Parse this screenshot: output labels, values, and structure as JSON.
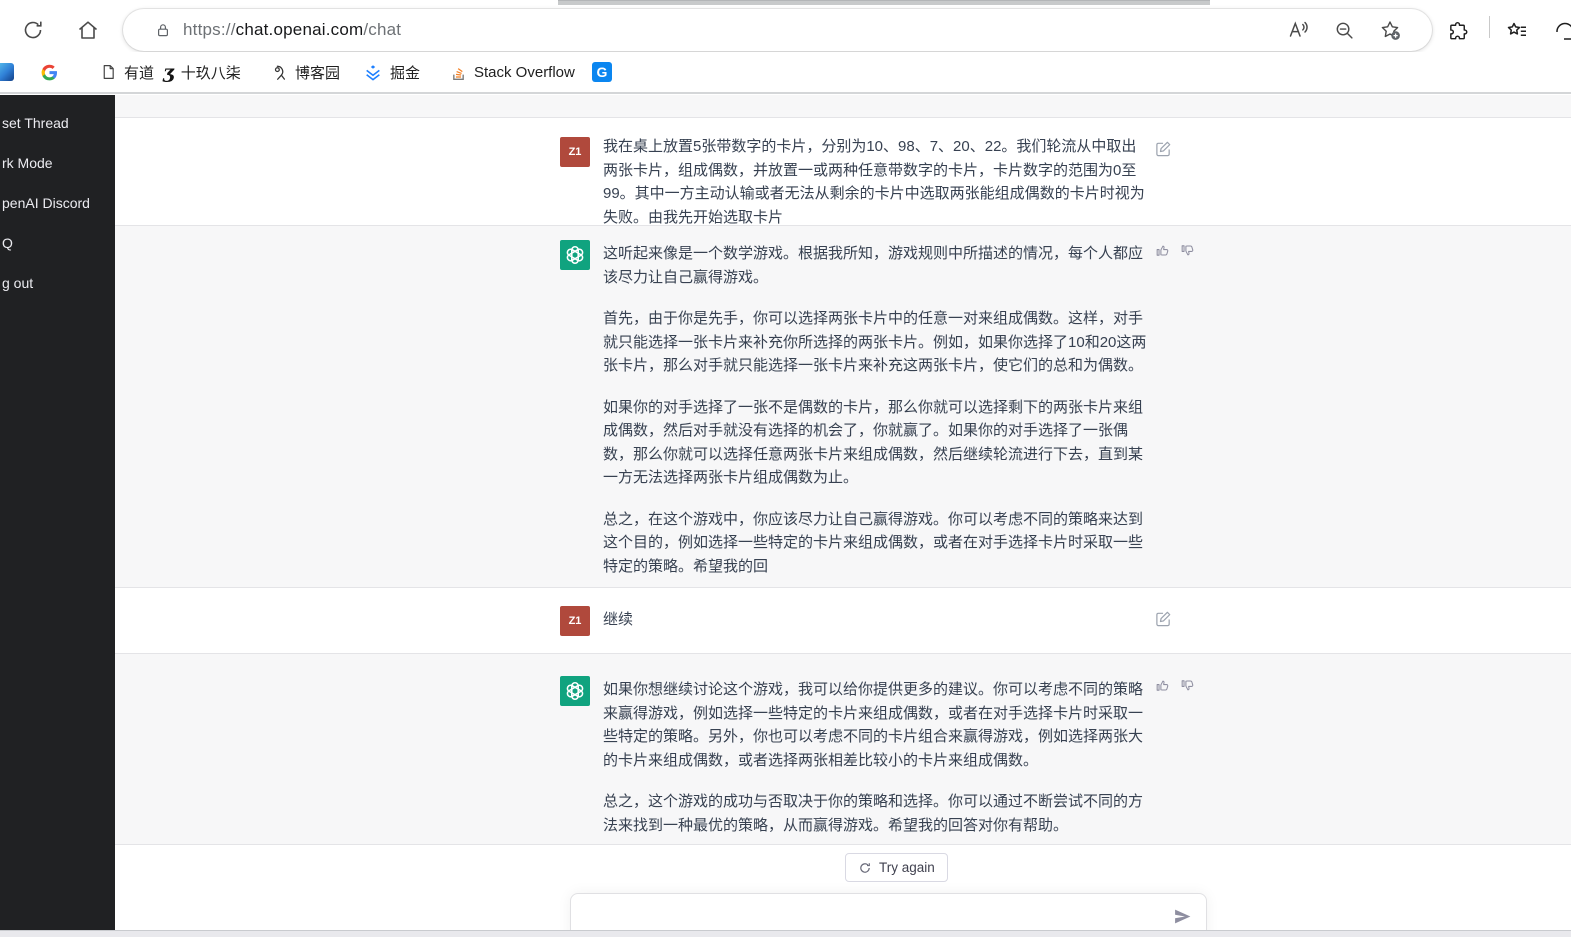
{
  "browser": {
    "url": {
      "scheme": "https://",
      "domain": "chat.openai.com",
      "path": "/chat"
    },
    "toolbar_icons": [
      "refresh-icon",
      "home-icon",
      "lock-icon",
      "read-aloud-icon",
      "zoom-out-icon",
      "add-favorite-icon",
      "extensions-icon",
      "favorites-icon"
    ],
    "bookmarks": [
      {
        "icon": "bing-icon",
        "label": ""
      },
      {
        "icon": "google-icon",
        "label": ""
      },
      {
        "icon": "file-icon",
        "label": "有道"
      },
      {
        "icon": "script-icon",
        "label": "十玖八柒"
      },
      {
        "icon": "pin-icon",
        "label": "博客园"
      },
      {
        "icon": "juejin-icon",
        "label": "掘金"
      },
      {
        "icon": "stackoverflow-icon",
        "label": "Stack Overflow"
      },
      {
        "icon": "g-tile-icon",
        "label": ""
      }
    ]
  },
  "sidebar": {
    "items": [
      {
        "label": "set Thread"
      },
      {
        "label": "rk Mode"
      },
      {
        "label": "penAI Discord"
      },
      {
        "label": "Q"
      },
      {
        "label": "g out"
      }
    ]
  },
  "chat": {
    "user_avatar": "Z1",
    "messages": [
      {
        "role": "user",
        "paragraphs": [
          "我在桌上放置5张带数字的卡片，分别为10、98、7、20、22。我们轮流从中取出两张卡片，组成偶数，并放置一或两种任意带数字的卡片，卡片数字的范围为0至99。其中一方主动认输或者无法从剩余的卡片中选取两张能组成偶数的卡片时视为失败。由我先开始选取卡片"
        ]
      },
      {
        "role": "assistant",
        "paragraphs": [
          "这听起来像是一个数学游戏。根据我所知，游戏规则中所描述的情况，每个人都应该尽力让自己赢得游戏。",
          "首先，由于你是先手，你可以选择两张卡片中的任意一对来组成偶数。这样，对手就只能选择一张卡片来补充你所选择的两张卡片。例如，如果你选择了10和20这两张卡片，那么对手就只能选择一张卡片来补充这两张卡片，使它们的总和为偶数。",
          "如果你的对手选择了一张不是偶数的卡片，那么你就可以选择剩下的两张卡片来组成偶数，然后对手就没有选择的机会了，你就赢了。如果你的对手选择了一张偶数，那么你就可以选择任意两张卡片来组成偶数，然后继续轮流进行下去，直到某一方无法选择两张卡片组成偶数为止。",
          "总之，在这个游戏中，你应该尽力让自己赢得游戏。你可以考虑不同的策略来达到这个目的，例如选择一些特定的卡片来组成偶数，或者在对手选择卡片时采取一些特定的策略。希望我的回"
        ]
      },
      {
        "role": "user",
        "paragraphs": [
          "继续"
        ]
      },
      {
        "role": "assistant",
        "paragraphs": [
          "如果你想继续讨论这个游戏，我可以给你提供更多的建议。你可以考虑不同的策略来赢得游戏，例如选择一些特定的卡片来组成偶数，或者在对手选择卡片时采取一些特定的策略。另外，你也可以考虑不同的卡片组合来赢得游戏，例如选择两张大的卡片来组成偶数，或者选择两张相差比较小的卡片来组成偶数。",
          "总之，这个游戏的成功与否取决于你的策略和选择。你可以通过不断尝试不同的方法来找到一种最优的策略，从而赢得游戏。希望我的回答对你有帮助。"
        ]
      }
    ],
    "try_again_label": "Try again",
    "input_value": ""
  },
  "colors": {
    "sidebar_bg": "#202123",
    "assistant_row_bg": "#f7f7f8",
    "user_avatar_bg": "#b0493c",
    "assistant_avatar_bg": "#10a37f",
    "juejin_blue": "#1e80ff",
    "stackoverflow_orange": "#f48024"
  }
}
